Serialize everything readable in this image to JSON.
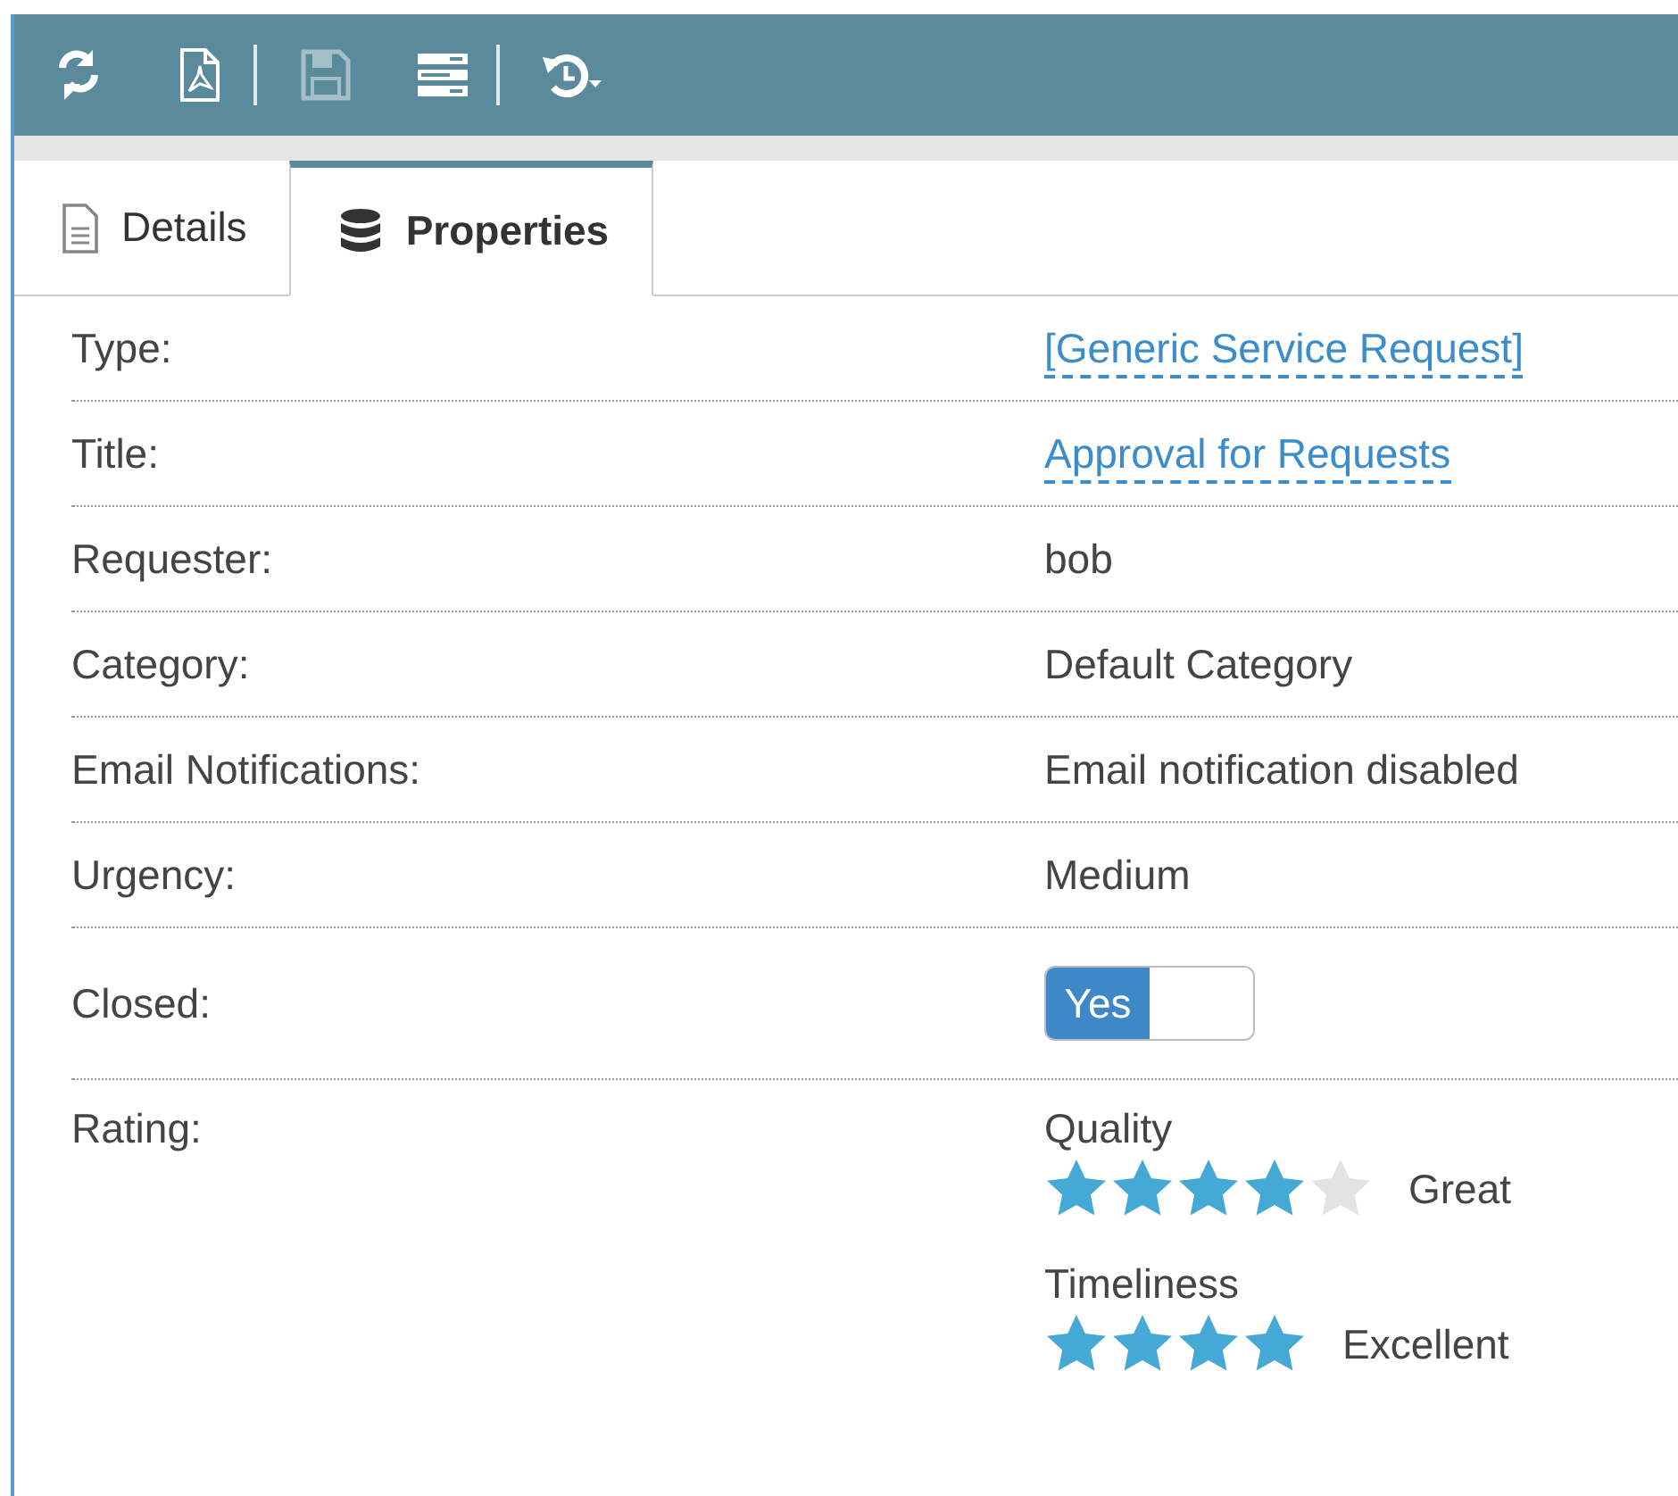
{
  "toolbar": {
    "buttons": [
      {
        "kind": "refresh",
        "disabled": false
      },
      {
        "kind": "pdf",
        "disabled": false
      },
      {
        "kind": "separator"
      },
      {
        "kind": "save",
        "disabled": true
      },
      {
        "kind": "list",
        "disabled": false
      },
      {
        "kind": "separator"
      },
      {
        "kind": "history",
        "disabled": false
      }
    ]
  },
  "tabs": [
    {
      "label": "Details",
      "kind": "document",
      "selected": false
    },
    {
      "label": "Properties",
      "kind": "database",
      "selected": true
    }
  ],
  "properties": [
    {
      "kind": "link",
      "label": "Type:",
      "value": "[Generic Service Request]"
    },
    {
      "kind": "link",
      "label": "Title:",
      "value": "Approval for Requests"
    },
    {
      "kind": "text",
      "label": "Requester:",
      "value": "bob"
    },
    {
      "kind": "text",
      "label": "Category:",
      "value": "Default Category"
    },
    {
      "kind": "text",
      "label": "Email Notifications:",
      "value": "Email notification disabled"
    },
    {
      "kind": "text",
      "label": "Urgency:",
      "value": "Medium"
    },
    {
      "kind": "toggle",
      "label": "Closed:",
      "value": "Yes",
      "checked": true
    },
    {
      "kind": "rating",
      "label": "Rating:",
      "ratings": [
        {
          "name": "Quality",
          "kind": "five",
          "stars": 4,
          "verdict": "Great"
        },
        {
          "name": "Timeliness",
          "kind": "four",
          "stars": 4,
          "verdict": "Excellent"
        }
      ]
    }
  ]
}
